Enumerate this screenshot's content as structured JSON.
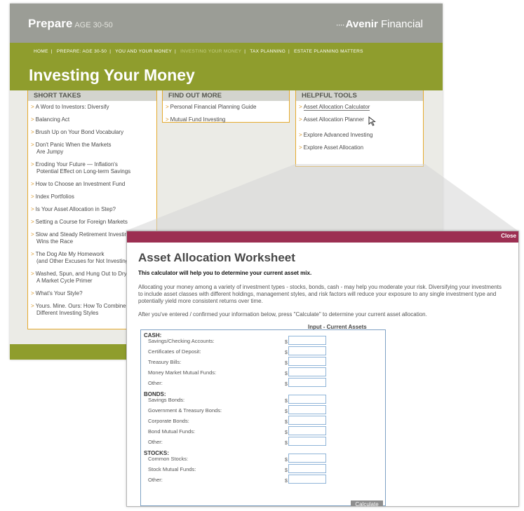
{
  "site": {
    "brand": "Prepare",
    "brand_age": "AGE 30-50",
    "logo_dots": "····",
    "logo_bold": "Avenir",
    "logo_rest": " Financial",
    "nav": [
      "HOME",
      "PREPARE: AGE 30-50",
      "YOU AND YOUR MONEY",
      "INVESTING YOUR MONEY",
      "TAX PLANNING",
      "ESTATE PLANNING MATTERS"
    ],
    "nav_separator": "|",
    "page_title": "Investing Your Money",
    "bullet": ">",
    "short_takes": {
      "heading": "SHORT TAKES",
      "items": [
        [
          "A Word to Investors: Diversify"
        ],
        [
          "Balancing Act"
        ],
        [
          "Brush Up on Your Bond Vocabulary"
        ],
        [
          "Don't Panic When the Markets",
          "Are Jumpy"
        ],
        [
          "Eroding Your Future — Inflation's",
          "Potential Effect on Long-term Savings"
        ],
        [
          "How to Choose an Investment Fund"
        ],
        [
          "Index Portfolios"
        ],
        [
          "Is Your Asset Allocation in Step?"
        ],
        [
          "Setting a Course for Foreign Markets"
        ],
        [
          "Slow and Steady Retirement Investing",
          "Wins the Race"
        ],
        [
          "The Dog Ate My Homework",
          "(and Other Excuses for Not Investing)"
        ],
        [
          "Washed, Spun, and Hung Out to Dry:",
          "A Market Cycle Primer"
        ],
        [
          "What's Your Style?"
        ],
        [
          "Yours. Mine. Ours: How To Combine",
          "Different Investing Styles"
        ]
      ]
    },
    "find_out_more": {
      "heading": "FIND OUT MORE",
      "items": [
        "Personal Financial Planning Guide",
        "Mutual Fund Investing"
      ]
    },
    "helpful_tools": {
      "heading": "HELPFUL TOOLS",
      "items": [
        "Asset Allocation Calculator",
        "Asset Allocation Planner",
        "Explore Advanced Investing",
        "Explore Asset Allocation"
      ]
    }
  },
  "dialog": {
    "close_label": "Close",
    "title": "Asset Allocation Worksheet",
    "subtitle": "This calculator will help you to determine your current asset mix.",
    "description": "Allocating your money among a variety of investment types - stocks, bonds, cash - may help you moderate your risk. Diversifying your investments to include asset classes with different holdings, management styles, and risk factors will reduce your exposure to any single investment type and potentially yield more consistent returns over time.",
    "instruction": "After you've entered / confirmed your information below, press \"Calculate\" to determine your current asset allocation.",
    "input_header": "Input - Current Assets",
    "currency_symbol": "$",
    "groups": [
      {
        "name": "CASH:",
        "fields": [
          "Savings/Checking Accounts:",
          "Certificates of Deposit:",
          "Treasury Bills:",
          "Money Market Mutual Funds:",
          "Other:"
        ]
      },
      {
        "name": "BONDS:",
        "fields": [
          "Savings Bonds:",
          "Government & Treasury Bonds:",
          "Corporate Bonds:",
          "Bond Mutual Funds:",
          "Other:"
        ]
      },
      {
        "name": "STOCKS:",
        "fields": [
          "Common Stocks:",
          "Stock Mutual Funds:",
          "Other:"
        ]
      }
    ],
    "calculate_label": "Calculate"
  },
  "colors": {
    "olive": "#8f9d2d",
    "topbar_gray": "#9b9d96",
    "accent_orange": "#e5aa2e",
    "dialog_bar": "#9c2f52",
    "field_border": "#8fb4d8"
  }
}
